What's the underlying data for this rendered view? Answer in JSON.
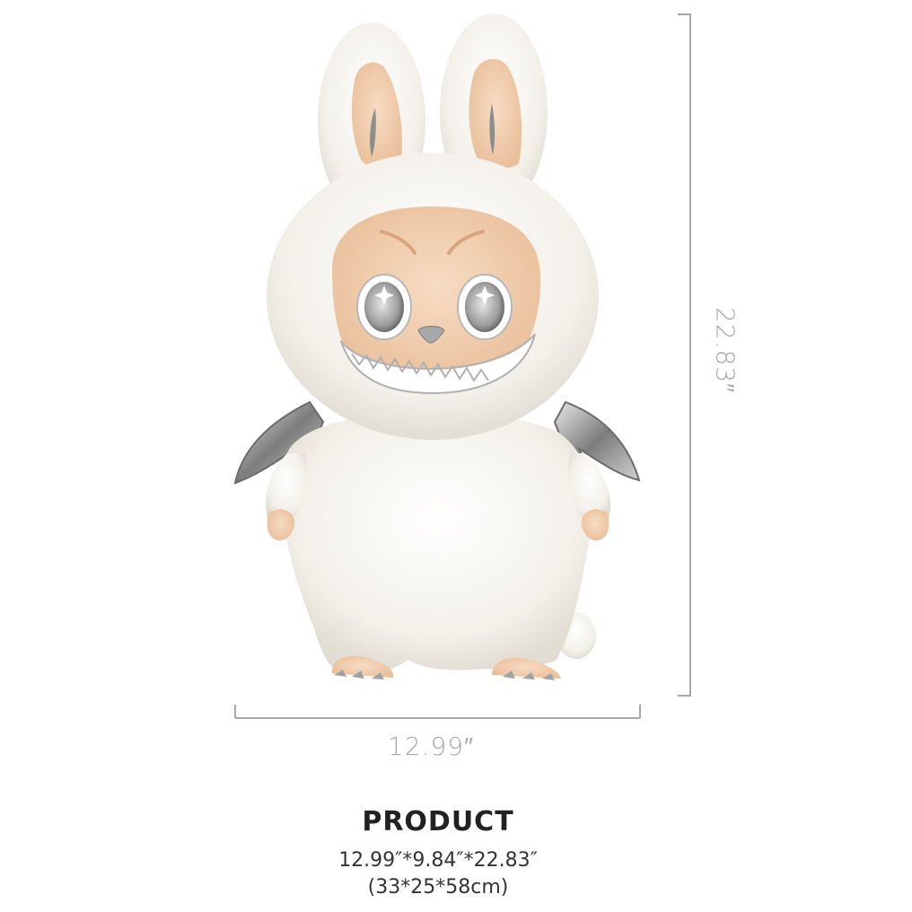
{
  "dimensions": {
    "width_label": "12.99″",
    "height_label": "22.83″"
  },
  "spec": {
    "title": "PRODUCT",
    "size_inches": "12.99″*9.84″*22.83″",
    "size_cm": "(33*25*58cm)"
  },
  "product_image": {
    "subject": "white furry plush figure with bunny ears, silver bat wings and toothy grin",
    "fur_color": "#f4f1ea",
    "skin_color": "#f2cfae",
    "metal_color": "#9a9a9a"
  }
}
